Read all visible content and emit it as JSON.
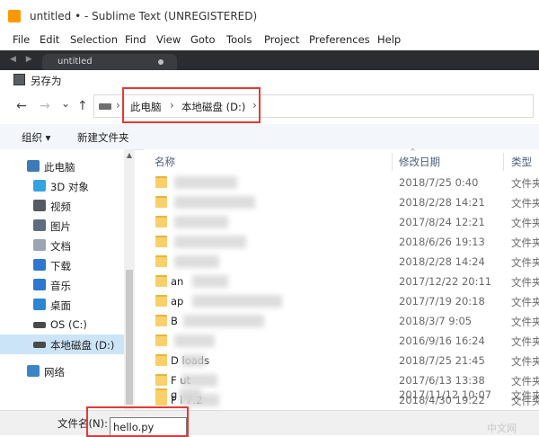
{
  "window": {
    "title": "untitled • - Sublime Text (UNREGISTERED)"
  },
  "menubar": [
    "File",
    "Edit",
    "Selection",
    "Find",
    "View",
    "Goto",
    "Tools",
    "Project",
    "Preferences",
    "Help"
  ],
  "editor": {
    "tab_label": "untitled",
    "nav_arrows": "◀ ▶"
  },
  "dialog": {
    "title": "另存为",
    "nav_icons": {
      "back": "←",
      "forward": "→",
      "dropdown": "⌄",
      "up": "↑"
    },
    "breadcrumb": [
      "此电脑",
      "本地磁盘 (D:)"
    ],
    "breadcrumb_sep": "›",
    "toolbar": {
      "organize": "组织 ▾",
      "new_folder": "新建文件夹"
    },
    "nav_pane": [
      {
        "label": "此电脑",
        "icon": "computer-icon",
        "color": "#3d7ab8"
      },
      {
        "label": "3D 对象",
        "icon": "cube-icon",
        "color": "#35a3e0"
      },
      {
        "label": "视频",
        "icon": "video-icon",
        "color": "#555b62"
      },
      {
        "label": "图片",
        "icon": "image-icon",
        "color": "#5c6d80"
      },
      {
        "label": "文档",
        "icon": "document-icon",
        "color": "#9aa6b3"
      },
      {
        "label": "下载",
        "icon": "download-icon",
        "color": "#2f77d1"
      },
      {
        "label": "音乐",
        "icon": "music-icon",
        "color": "#2f77d1"
      },
      {
        "label": "桌面",
        "icon": "desktop-icon",
        "color": "#2b86d6"
      },
      {
        "label": "OS (C:)",
        "icon": "os-drive-icon",
        "color": "#4a4a4a"
      },
      {
        "label": "本地磁盘 (D:)",
        "icon": "drive-icon",
        "color": "#4a4a4a"
      },
      {
        "label": "网络",
        "icon": "network-icon",
        "color": "#3b84c7"
      }
    ],
    "columns": {
      "name": "名称",
      "date": "修改日期",
      "type": "类型",
      "sort_caret": "^"
    },
    "files": [
      {
        "name": "",
        "date": "2018/7/25 0:40",
        "type": "文件夹"
      },
      {
        "name": "",
        "date": "2018/2/28 14:21",
        "type": "文件夹"
      },
      {
        "name": "",
        "date": "2017/8/24 12:21",
        "type": "文件夹"
      },
      {
        "name": "",
        "date": "2018/6/26 19:13",
        "type": "文件夹"
      },
      {
        "name": "",
        "date": "2018/2/28 14:24",
        "type": "文件夹"
      },
      {
        "name": "an",
        "date": "2017/12/22 20:11",
        "type": "文件夹"
      },
      {
        "name": "ap",
        "date": "2017/7/19 20:18",
        "type": "文件夹"
      },
      {
        "name": "B",
        "date": "2018/3/7 9:05",
        "type": "文件夹"
      },
      {
        "name": "",
        "date": "2016/9/16 16:24",
        "type": "文件夹"
      },
      {
        "name": "D    loads",
        "date": "2018/7/25 21:45",
        "type": "文件夹"
      },
      {
        "name": "F      ut",
        "date": "2017/6/13 13:38",
        "type": "文件夹"
      },
      {
        "name": "F       l 7.2",
        "date": "2018/4/30 19:22",
        "type": "文件夹"
      },
      {
        "name": "g",
        "date": "2017/11/12 10:07",
        "type": "文件夹"
      }
    ],
    "footer": {
      "filename_label": "文件名(N):",
      "filename_value": "hello.py"
    },
    "watermark": "中文网"
  },
  "colors": {
    "highlight": "#e53935",
    "selected": "#cce4f7",
    "folder": "#f9d06a",
    "tabbar": "#2a2c2f"
  }
}
